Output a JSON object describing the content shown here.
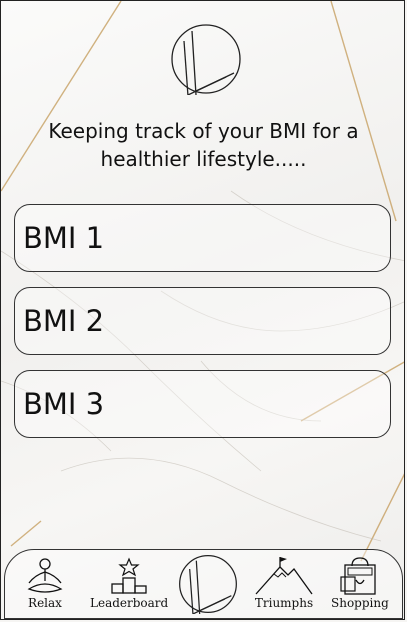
{
  "tagline": "Keeping track of your BMI for a healthier lifestyle.....",
  "bmi_buttons": [
    {
      "label": "BMI 1"
    },
    {
      "label": "BMI 2"
    },
    {
      "label": "BMI 3"
    }
  ],
  "nav": {
    "relax": {
      "label": "Relax",
      "icon": "meditation-icon"
    },
    "leaderboard": {
      "label": "Leaderboard",
      "icon": "podium-icon"
    },
    "home": {
      "icon": "logo-icon"
    },
    "triumphs": {
      "label": "Triumphs",
      "icon": "mountain-flag-icon"
    },
    "shopping": {
      "label": "Shopping",
      "icon": "shopping-bag-icon"
    }
  },
  "colors": {
    "background": "#f6f5f3",
    "vein_gold": "#c9a46a",
    "outline": "#333333"
  }
}
